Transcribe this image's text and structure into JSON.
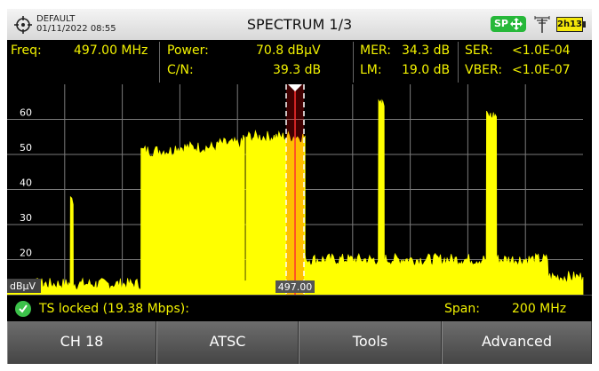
{
  "header": {
    "profile": "DEFAULT",
    "datetime": "01/11/2022 08:55",
    "title": "SPECTRUM 1/3",
    "sp_badge": "SP",
    "battery": "2h13"
  },
  "measurements": {
    "freq_label": "Freq:",
    "freq_value": "497.00 MHz",
    "power_label": "Power:",
    "power_value": "70.8 dBµV",
    "cn_label": "C/N:",
    "cn_value": "39.3 dB",
    "mer_label": "MER:",
    "mer_value": "34.3 dB",
    "lm_label": "LM:",
    "lm_value": "19.0 dB",
    "ser_label": "SER:",
    "ser_value": "<1.0E-04",
    "vber_label": "VBER:",
    "vber_value": "<1.0E-07"
  },
  "spectrum": {
    "y_unit": "dBµV",
    "y_ticks": [
      "60",
      "50",
      "40",
      "30",
      "20"
    ],
    "marker_label": "497.00",
    "colors": {
      "trace": "#ffff00",
      "grid": "#7a7a7a",
      "marker": "#ff3030"
    }
  },
  "chart_data": {
    "type": "area",
    "ylabel": "dBµV",
    "ylim": [
      10,
      70
    ],
    "x_center_mhz": 497.0,
    "span_mhz": 200,
    "series": [
      {
        "x": [
          397,
          410,
          418,
          419,
          420,
          428,
          437,
          443,
          443.5,
          455,
          470,
          479,
          479.5,
          480,
          490,
          500,
          500.5,
          501,
          515,
          523,
          524.5,
          526,
          527,
          528,
          533,
          534,
          535,
          555,
          562,
          563.5,
          565,
          566,
          567,
          575,
          585,
          597
        ],
        "y": [
          13,
          13,
          13,
          37,
          13,
          13,
          13,
          13,
          51,
          52,
          53,
          55,
          13,
          55,
          55,
          55,
          20,
          20,
          20,
          20,
          20,
          64,
          64,
          20,
          20,
          20,
          20,
          20,
          20,
          61,
          61,
          61,
          20,
          20,
          15,
          15
        ]
      }
    ]
  },
  "status": {
    "ts_locked": "TS locked (19.38 Mbps):",
    "span_label": "Span:",
    "span_value": "200 MHz"
  },
  "softkeys": [
    "CH 18",
    "ATSC",
    "Tools",
    "Advanced"
  ]
}
